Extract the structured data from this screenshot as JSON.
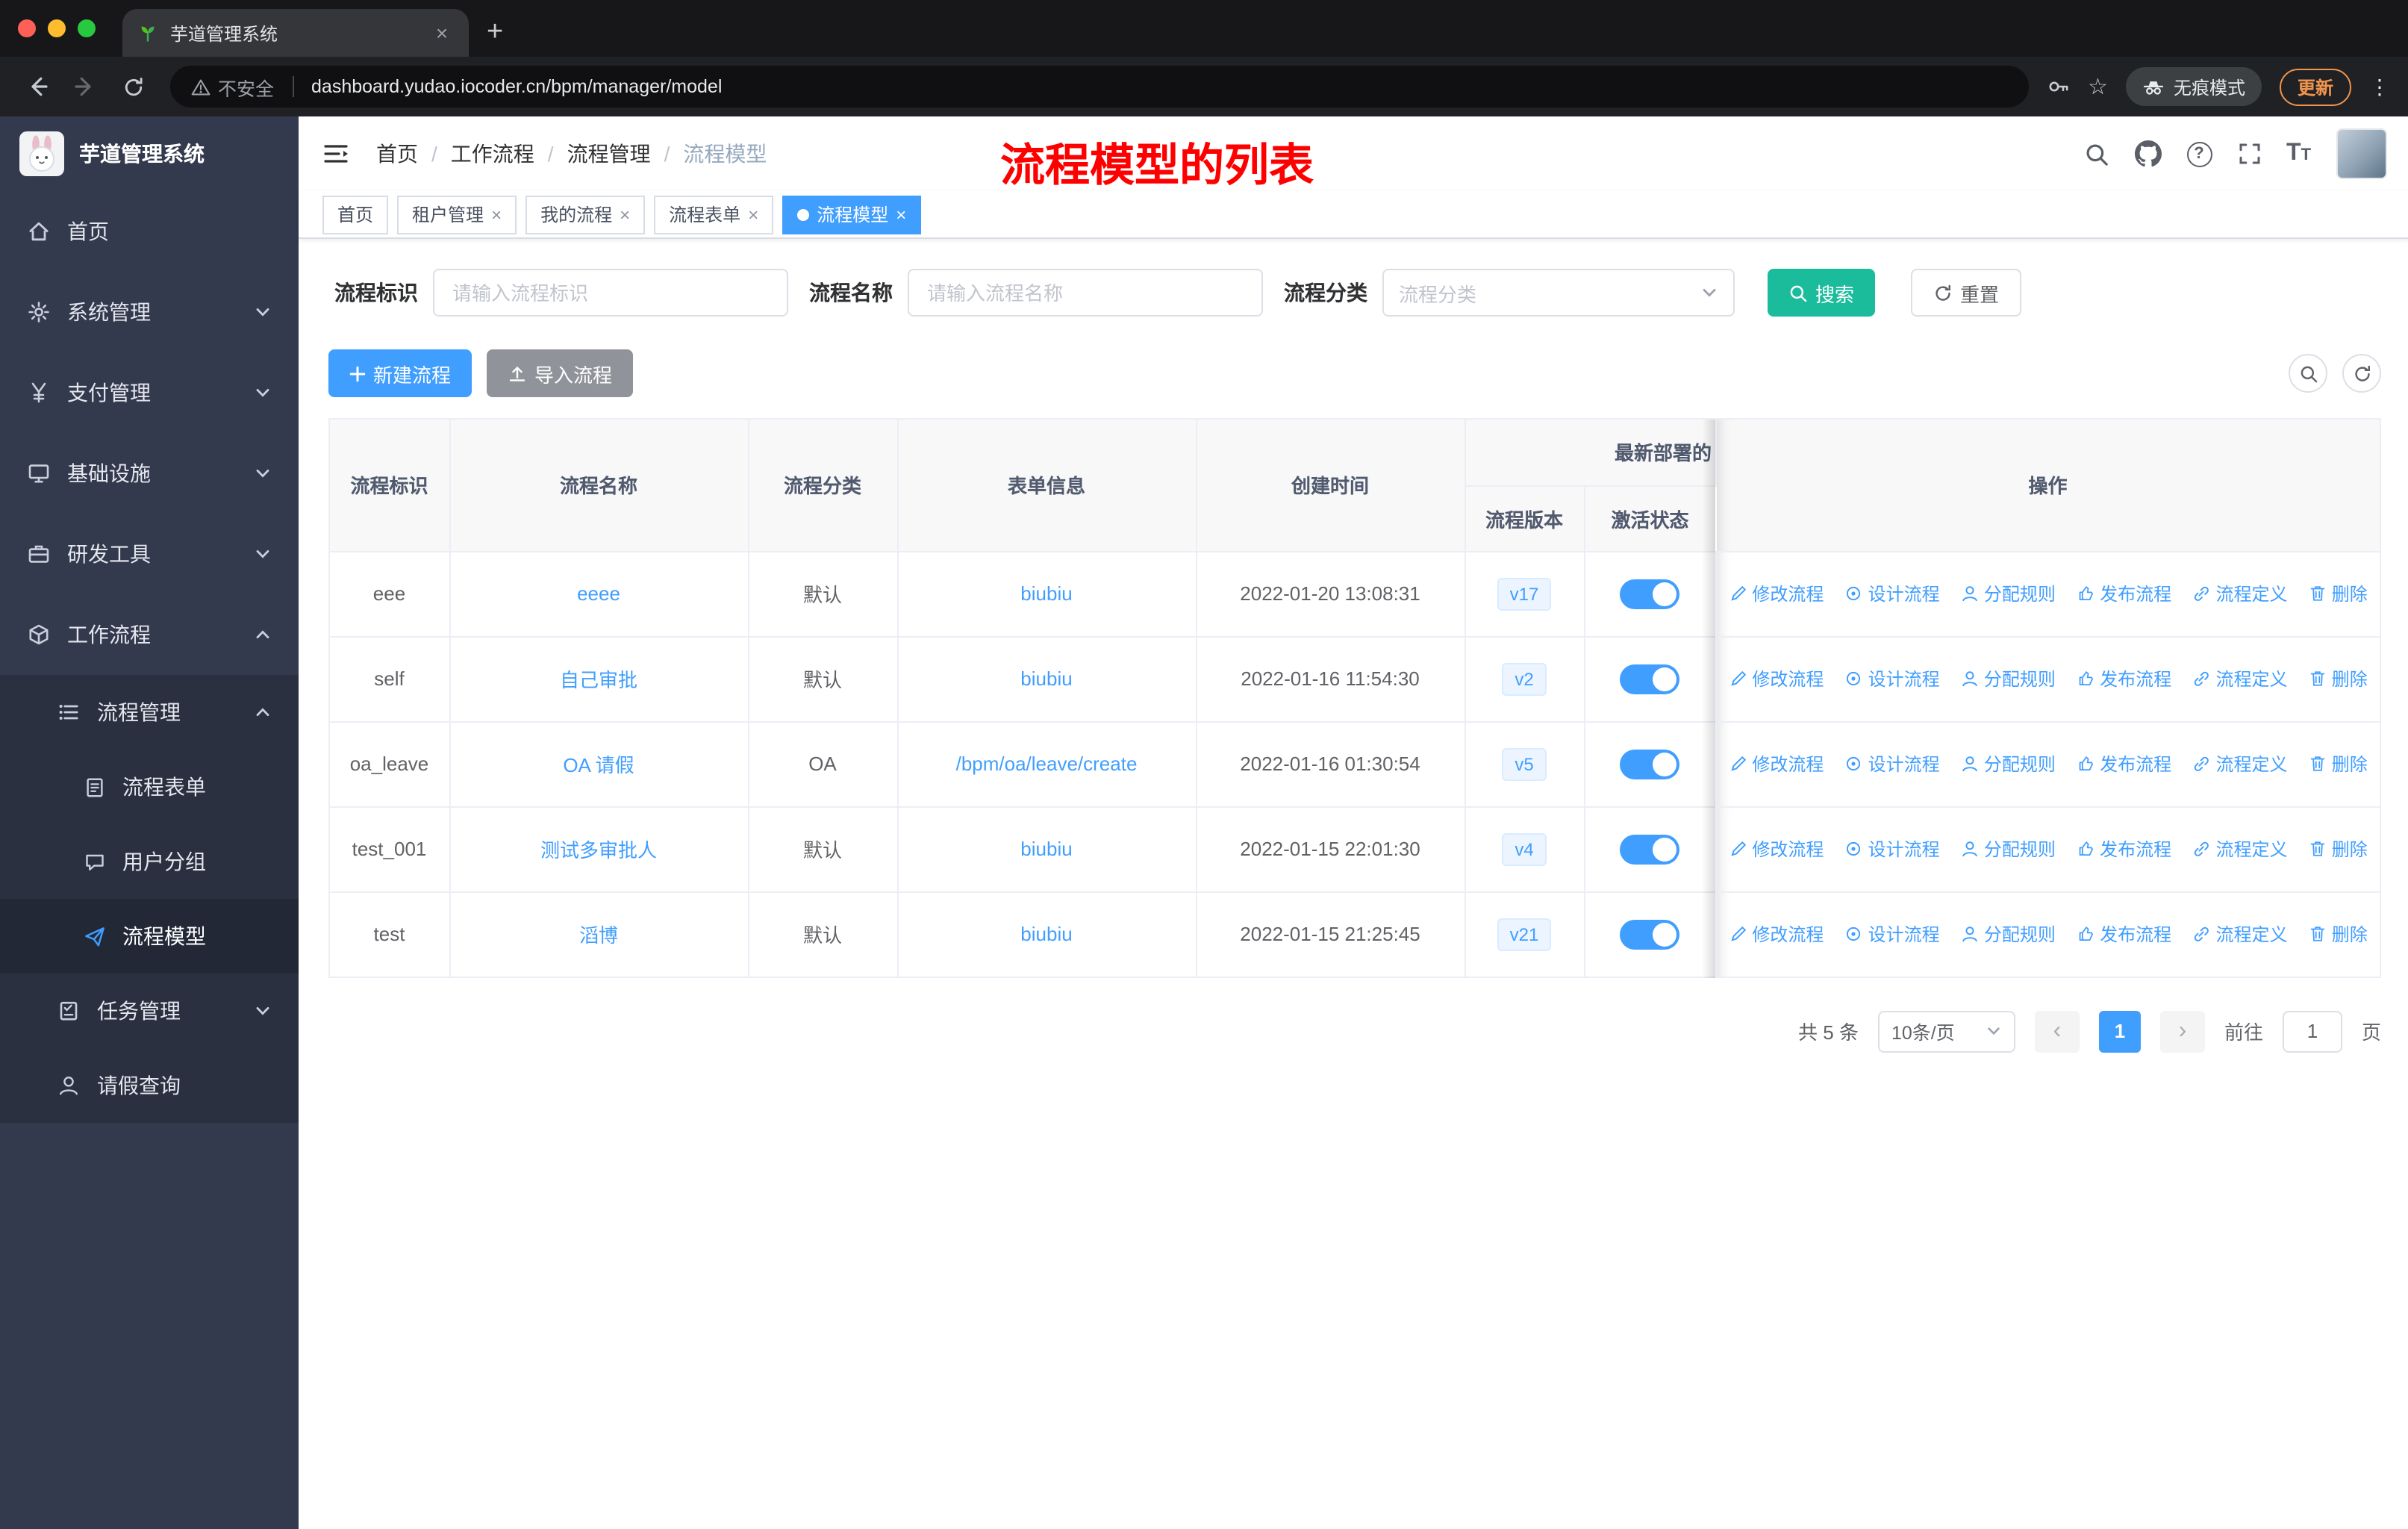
{
  "colors": {
    "primary": "#409EFF",
    "search_button": "#1ABC9C",
    "annotation_red": "#FF0000",
    "import_button": "#909399",
    "sidebar_bg": "#333A4D",
    "toggle_on": "#409EFF"
  },
  "icons": {
    "star": "☆",
    "kebab": "⋮",
    "close": "×",
    "plus": "+",
    "prev": "‹",
    "next": "›",
    "sep": "/",
    "question": "?",
    "font_large": "T",
    "font_small": "T"
  },
  "browser": {
    "tab_title": "芋道管理系统",
    "security_label": "不安全",
    "url": "dashboard.yudao.iocoder.cn/bpm/manager/model",
    "incognito_label": "无痕模式",
    "update_label": "更新"
  },
  "sidebar": {
    "logo_title": "芋道管理系统",
    "menu": [
      {
        "label": "首页"
      },
      {
        "label": "系统管理"
      },
      {
        "label": "支付管理"
      },
      {
        "label": "基础设施"
      },
      {
        "label": "研发工具"
      },
      {
        "label": "工作流程"
      },
      {
        "label": "流程管理"
      },
      {
        "label": "流程表单"
      },
      {
        "label": "用户分组"
      },
      {
        "label": "流程模型"
      },
      {
        "label": "任务管理"
      },
      {
        "label": "请假查询"
      }
    ]
  },
  "navbar": {
    "breadcrumb": [
      "首页",
      "工作流程",
      "流程管理",
      "流程模型"
    ],
    "annotation": "流程模型的列表"
  },
  "tags": [
    {
      "label": "首页"
    },
    {
      "label": "租户管理"
    },
    {
      "label": "我的流程"
    },
    {
      "label": "流程表单"
    },
    {
      "label": "流程模型"
    }
  ],
  "filters": {
    "id_label": "流程标识",
    "id_placeholder": "请输入流程标识",
    "name_label": "流程名称",
    "name_placeholder": "请输入流程名称",
    "category_label": "流程分类",
    "category_placeholder": "流程分类",
    "search_label": "搜索",
    "reset_label": "重置"
  },
  "toolbar": {
    "create_label": "新建流程",
    "import_label": "导入流程"
  },
  "table": {
    "headers": {
      "id": "流程标识",
      "name": "流程名称",
      "category": "流程分类",
      "form": "表单信息",
      "created": "创建时间",
      "deploy_group": "最新部署的",
      "version": "流程版本",
      "status": "激活状态",
      "ops": "操作"
    },
    "actions": [
      {
        "label": "修改流程"
      },
      {
        "label": "设计流程"
      },
      {
        "label": "分配规则"
      },
      {
        "label": "发布流程"
      },
      {
        "label": "流程定义"
      },
      {
        "label": "删除"
      }
    ],
    "rows": [
      {
        "id": "eee",
        "name": "eeee",
        "category": "默认",
        "form": "biubiu",
        "created": "2022-01-20 13:08:31",
        "version": "v17"
      },
      {
        "id": "self",
        "name": "自己审批",
        "category": "默认",
        "form": "biubiu",
        "created": "2022-01-16 11:54:30",
        "version": "v2"
      },
      {
        "id": "oa_leave",
        "name": "OA 请假",
        "category": "OA",
        "form": "/bpm/oa/leave/create",
        "created": "2022-01-16 01:30:54",
        "version": "v5"
      },
      {
        "id": "test_001",
        "name": "测试多审批人",
        "category": "默认",
        "form": "biubiu",
        "created": "2022-01-15 22:01:30",
        "version": "v4"
      },
      {
        "id": "test",
        "name": "滔博",
        "category": "默认",
        "form": "biubiu",
        "created": "2022-01-15 21:25:45",
        "version": "v21"
      }
    ]
  },
  "pagination": {
    "total": "共 5 条",
    "page_size": "10条/页",
    "current": "1",
    "goto_label": "前往",
    "goto_value": "1",
    "page_unit": "页"
  }
}
